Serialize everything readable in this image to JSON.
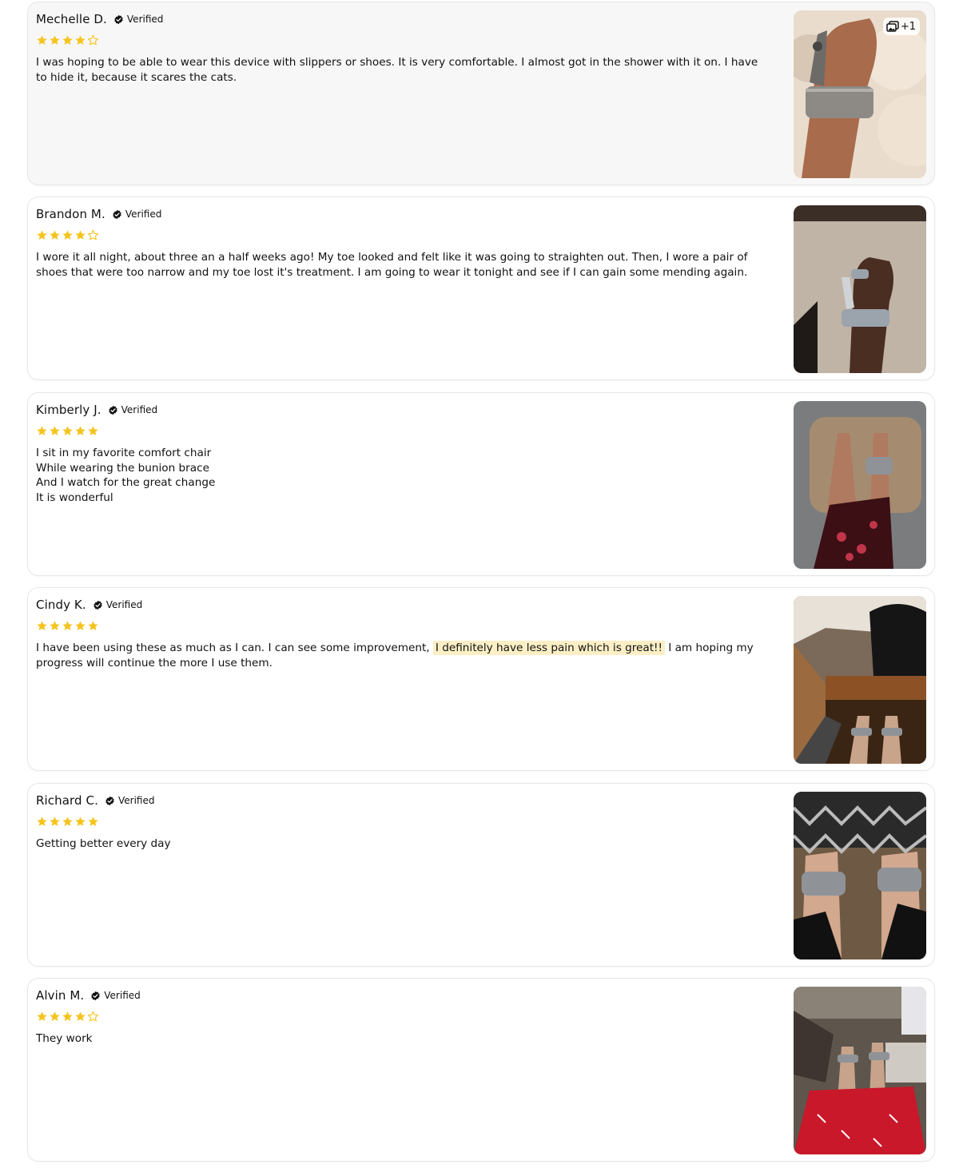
{
  "reviews": [
    {
      "author": "Mechelle D.",
      "verified": "Verified",
      "rating": 4,
      "text": "I was hoping to be able to wear this device with slippers or shoes.  It is very comfortable.  I almost got in the shower with it on.  I have to hide it, because it scares the cats.",
      "photo_count": "+1",
      "photo_desc": "foot-with-bunion-brace-on-sherpa-blanket"
    },
    {
      "author": "Brandon M.",
      "verified": "Verified",
      "rating": 4,
      "text": "I wore it all night, about three an a half weeks ago!  My toe looked and felt like it was going to straighten out.   Then, I wore a pair of shoes that were too narrow and my toe lost it's treatment.  I am going to wear it tonight and see if I can gain some mending again.",
      "photo_desc": "foot-with-brace-on-carpet"
    },
    {
      "author": "Kimberly J.",
      "verified": "Verified",
      "rating": 5,
      "text": "I sit in my favorite comfort chair\nWhile wearing the bunion brace\nAnd I watch for the great change\nIt is wonderful",
      "photo_desc": "feet-with-braces-on-pillow"
    },
    {
      "author": "Cindy K.",
      "verified": "Verified",
      "rating": 5,
      "text_before": "I have been using these as much as I can. I can see some improvement, ",
      "text_highlight": "I definitely have less pain which is great!!",
      "text_after": " I am hoping my progress will continue the more I use them.",
      "photo_desc": "feet-with-braces-on-footstool"
    },
    {
      "author": "Richard C.",
      "verified": "Verified",
      "rating": 5,
      "text": "Getting better every day",
      "photo_desc": "feet-with-braces-on-floor"
    },
    {
      "author": "Alvin M.",
      "verified": "Verified",
      "rating": 4,
      "text": "They work",
      "photo_desc": "feet-with-braces-red-pajamas"
    }
  ],
  "colors": {
    "star": "#f6c31c",
    "highlight": "#fcefc5",
    "active_card": "#f7f7f7"
  },
  "icons": {
    "verified": "check-badge-icon",
    "star_filled": "star-filled-icon",
    "star_empty": "star-outline-icon",
    "gallery": "gallery-icon"
  }
}
